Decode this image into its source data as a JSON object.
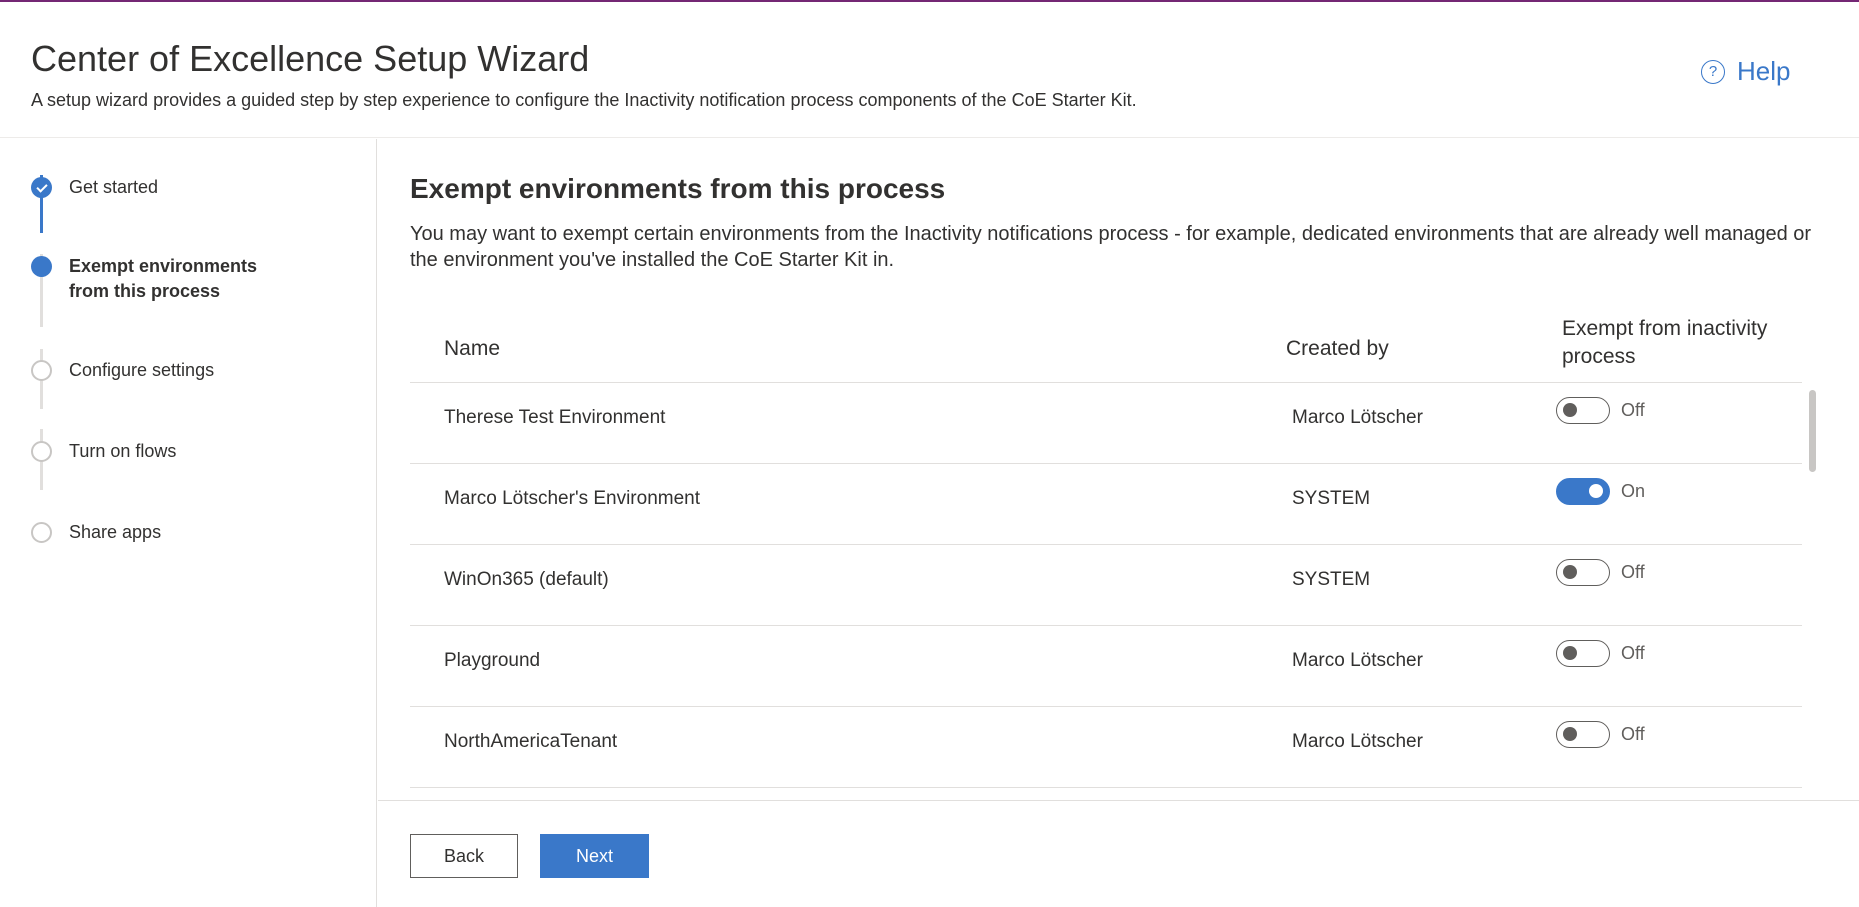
{
  "header": {
    "title": "Center of Excellence Setup Wizard",
    "subtitle": "A setup wizard provides a guided step by step experience to configure the Inactivity notification process components of the CoE Starter Kit.",
    "help_label": "Help",
    "help_icon": "?"
  },
  "steps": [
    {
      "label": "Get started",
      "state": "done"
    },
    {
      "label": "Exempt environments\nfrom this process",
      "state": "current"
    },
    {
      "label": "Configure settings",
      "state": "todo"
    },
    {
      "label": "Turn on flows",
      "state": "todo"
    },
    {
      "label": "Share apps",
      "state": "todo"
    }
  ],
  "main": {
    "title": "Exempt environments from this process",
    "description": "You may want to exempt certain environments from the Inactivity notifications process - for example, dedicated environments that are already well managed or the environment you've installed the CoE Starter Kit in."
  },
  "table": {
    "columns": {
      "name": "Name",
      "created_by": "Created by",
      "exempt": "Exempt from inactivity process"
    },
    "rows": [
      {
        "name": "Therese Test Environment",
        "created_by": "Marco Lötscher",
        "exempt": false,
        "toggle_label": "Off"
      },
      {
        "name": "Marco Lötscher's Environment",
        "created_by": "SYSTEM",
        "exempt": true,
        "toggle_label": "On"
      },
      {
        "name": "WinOn365 (default)",
        "created_by": "SYSTEM",
        "exempt": false,
        "toggle_label": "Off"
      },
      {
        "name": "Playground",
        "created_by": "Marco Lötscher",
        "exempt": false,
        "toggle_label": "Off"
      },
      {
        "name": "NorthAmericaTenant",
        "created_by": "Marco Lötscher",
        "exempt": false,
        "toggle_label": "Off"
      }
    ]
  },
  "footer": {
    "back_label": "Back",
    "next_label": "Next"
  },
  "colors": {
    "accent": "#3a78c9",
    "brand_bar": "#742774",
    "text": "#323130"
  }
}
